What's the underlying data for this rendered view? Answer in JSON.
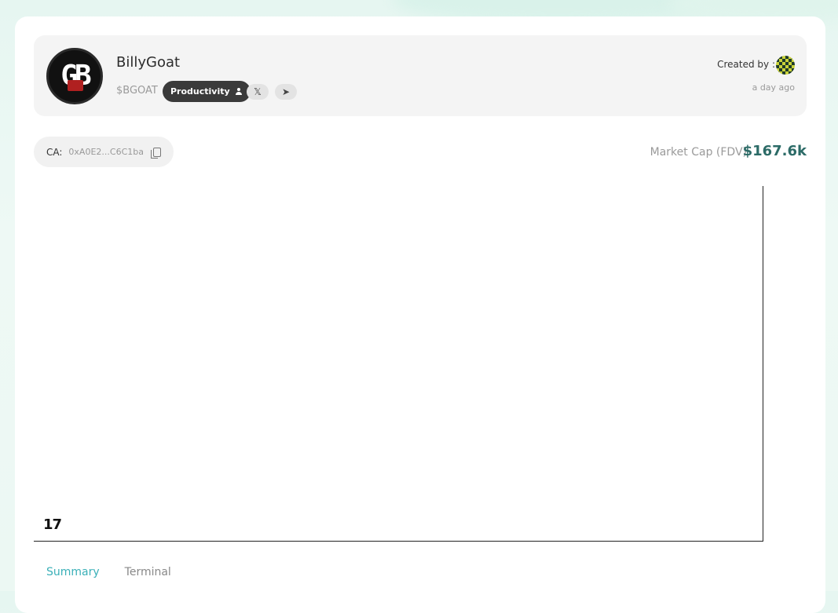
{
  "token": {
    "name": "BillyGoat",
    "ticker": "$BGOAT",
    "category": "Productivity",
    "logo_text": "GB"
  },
  "social": {
    "x_label": "𝕏",
    "telegram_label": "➤"
  },
  "creator": {
    "label": "Created by :",
    "time": "a day ago"
  },
  "contract": {
    "label": "CA:",
    "value": "0xA0E2...C6C1ba"
  },
  "market": {
    "label": "Market Cap (FDV)",
    "value": "$167.6k"
  },
  "chart": {
    "watermark": "17"
  },
  "tabs": [
    {
      "label": "Summary",
      "active": true
    },
    {
      "label": "Terminal",
      "active": false
    }
  ],
  "colors": {
    "accent": "#3bb0b8",
    "market_value": "#2c6b67",
    "pill_bg": "#3a3a3a"
  }
}
